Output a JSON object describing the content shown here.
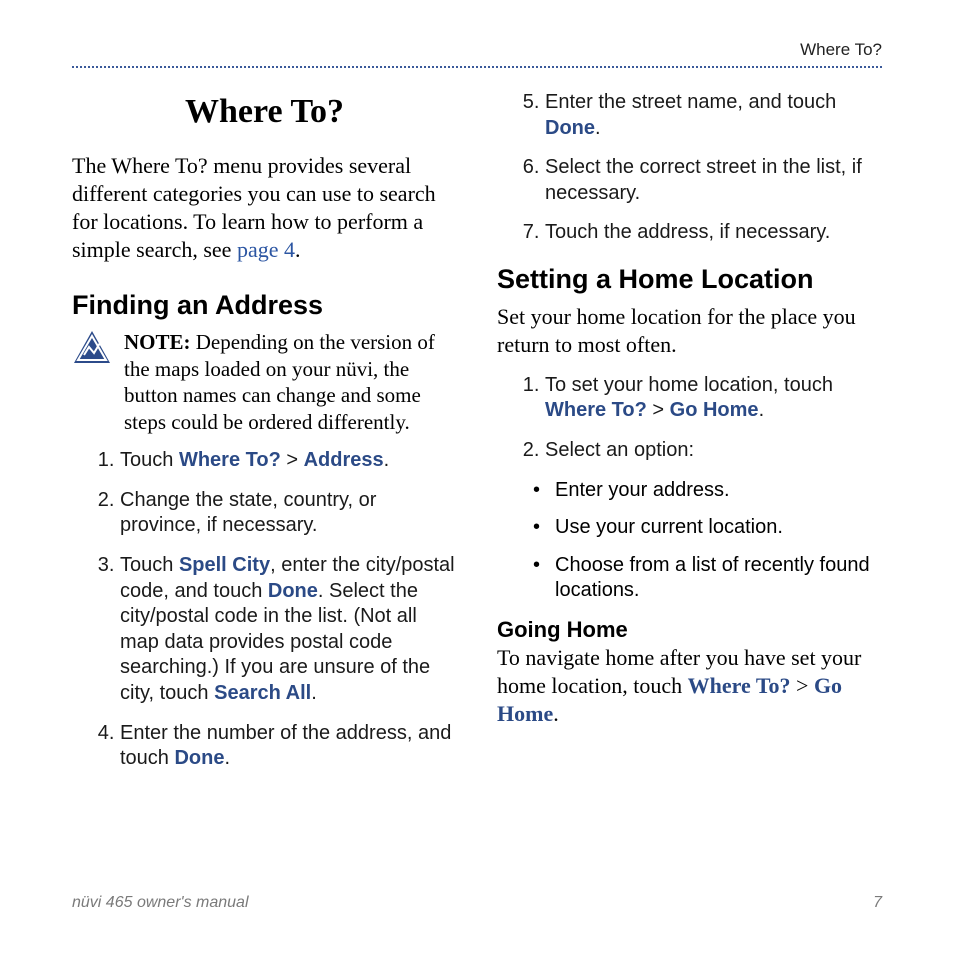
{
  "header": {
    "running": "Where To?"
  },
  "left": {
    "title": "Where To?",
    "intro_before": "The Where To? menu provides several different categories you can use to search for locations. To learn how to perform a simple search, see ",
    "intro_link": "page 4",
    "intro_after": ".",
    "h2": "Finding an Address",
    "note_label": "NOTE:",
    "note_body": " Depending on the version of the maps loaded on your nüvi, the button names can change and some steps could be ordered differently.",
    "step1_a": "Touch ",
    "step1_cmd1": "Where To?",
    "step1_b": " > ",
    "step1_cmd2": "Address",
    "step1_c": ".",
    "step2": "Change the state, country, or province, if necessary.",
    "step3_a": "Touch ",
    "step3_cmd1": "Spell City",
    "step3_b": ", enter the city/postal code, and touch ",
    "step3_cmd2": "Done",
    "step3_c": ". Select the city/postal code in the list. (Not all map data provides postal code searching.) If you are unsure of the city, touch ",
    "step3_cmd3": "Search All",
    "step3_d": ".",
    "step4_a": "Enter the number of the address, and touch ",
    "step4_cmd": "Done",
    "step4_b": "."
  },
  "right": {
    "step5_a": "Enter the street name, and touch ",
    "step5_cmd": "Done",
    "step5_b": ".",
    "step6": "Select the correct street in the list, if necessary.",
    "step7": "Touch the address, if necessary.",
    "h2": "Setting a Home Location",
    "intro": "Set your home location for the place you return to most often.",
    "s1_a": "To set your home location, touch ",
    "s1_cmd1": "Where To?",
    "s1_b": " > ",
    "s1_cmd2": "Go Home",
    "s1_c": ".",
    "s2": "Select an option:",
    "opt1": "Enter your address.",
    "opt2": "Use your current location.",
    "opt3": "Choose from a list of recently found locations.",
    "h3": "Going Home",
    "gh_a": "To navigate home after you have set your home location, touch ",
    "gh_cmd1": "Where To?",
    "gh_b": " > ",
    "gh_cmd2": "Go Home",
    "gh_c": "."
  },
  "footer": {
    "left": "nüvi 465 owner's manual",
    "right": "7"
  }
}
